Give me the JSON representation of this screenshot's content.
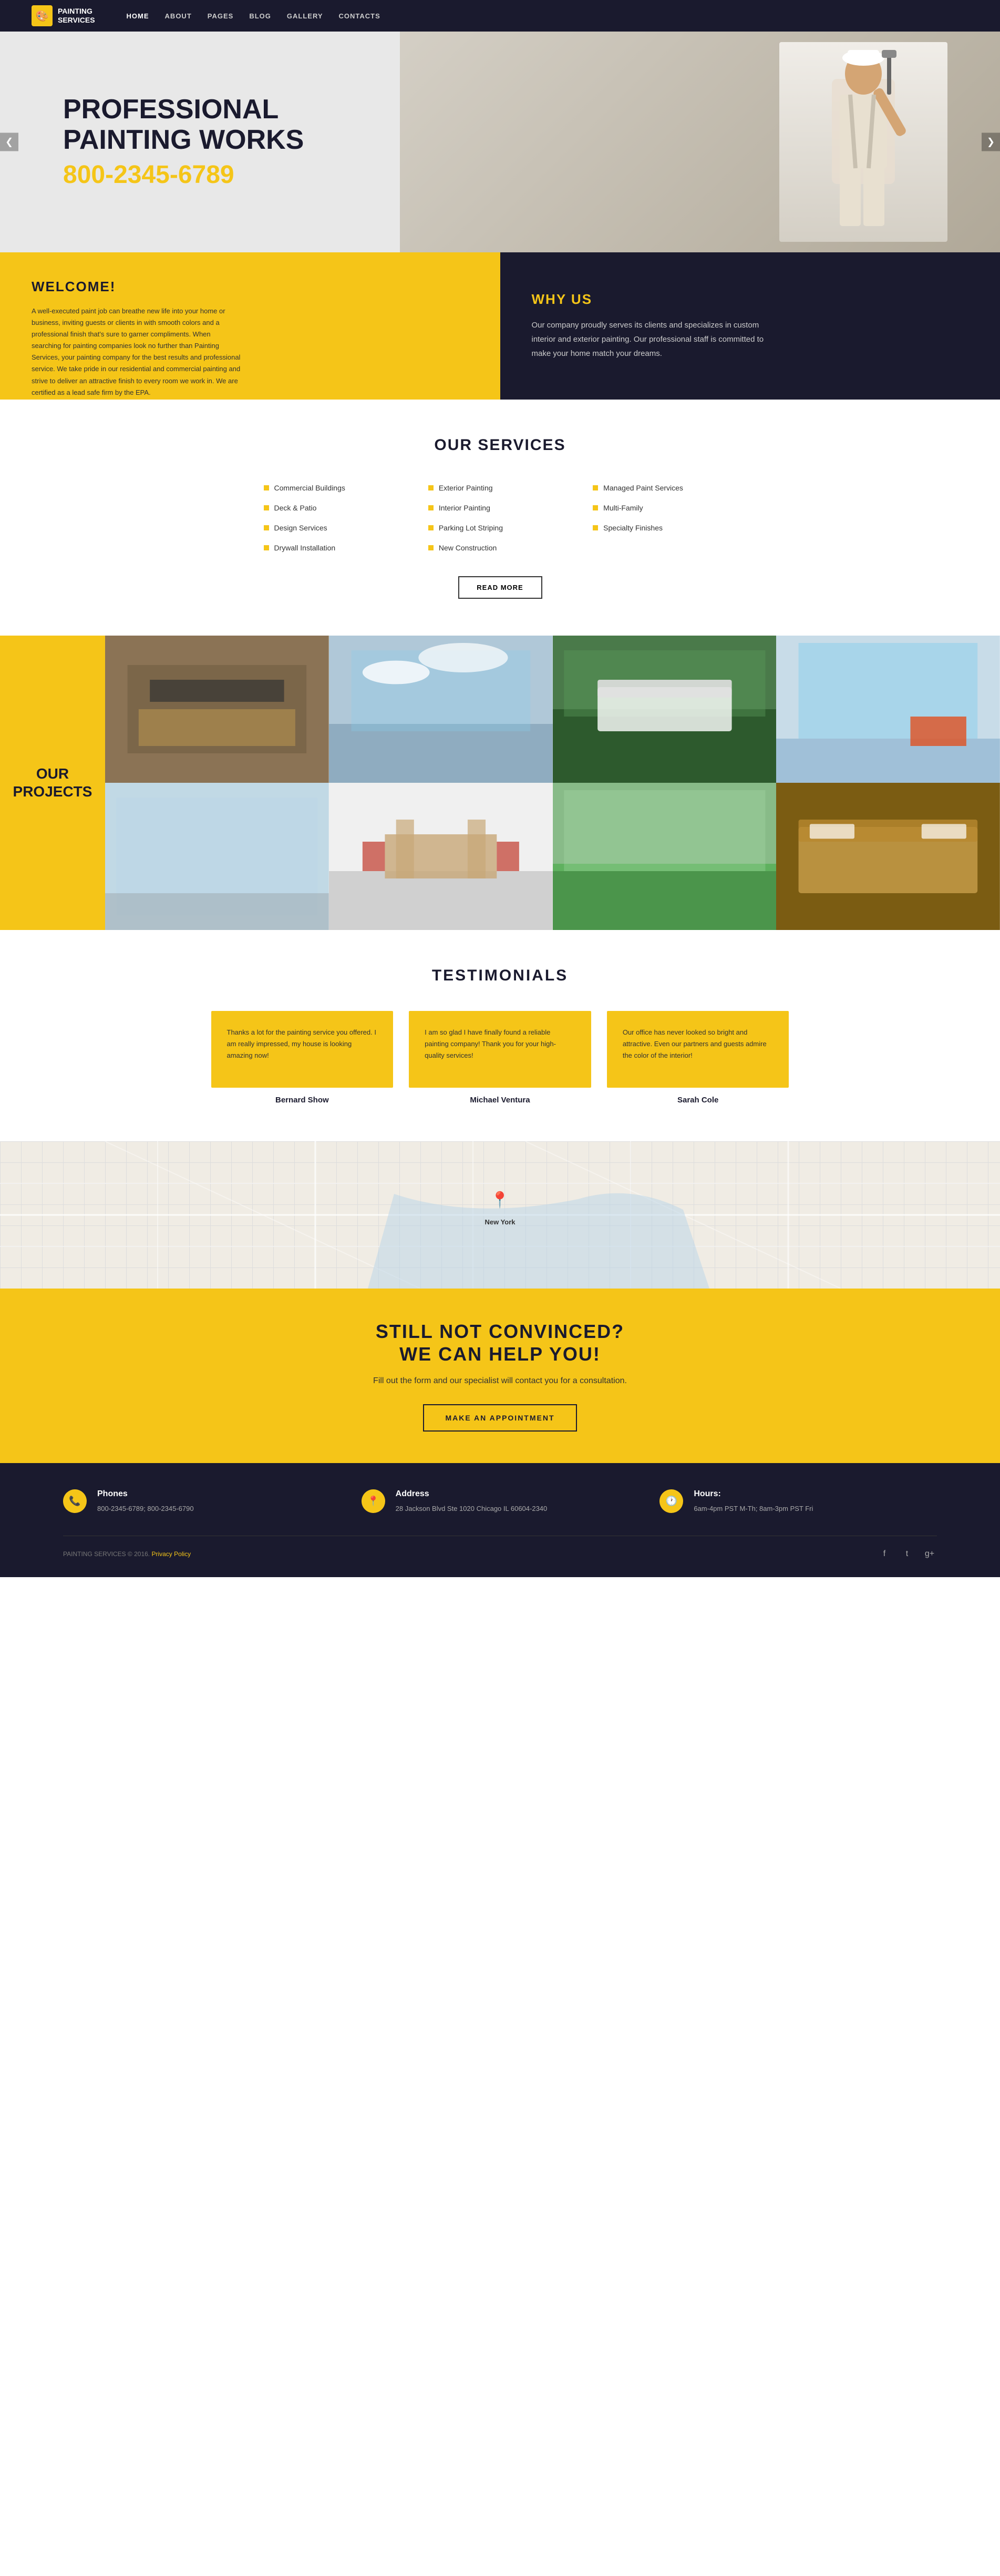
{
  "nav": {
    "logo_icon": "🎨",
    "logo_line1": "PAINTING",
    "logo_line2": "SERVICES",
    "links": [
      {
        "label": "HOME",
        "active": true
      },
      {
        "label": "ABOUT",
        "active": false
      },
      {
        "label": "PAGES",
        "active": false
      },
      {
        "label": "BLOG",
        "active": false
      },
      {
        "label": "GALLERY",
        "active": false
      },
      {
        "label": "CONTACTS",
        "active": false
      }
    ]
  },
  "hero": {
    "title_line1": "PROFESSIONAL",
    "title_line2": "PAINTING WORKS",
    "phone": "800-2345-6789",
    "arrow_left": "❮",
    "arrow_right": "❯"
  },
  "welcome": {
    "title": "WELCOME!",
    "body": "A well-executed paint job can breathe new life into your home or business, inviting guests or clients in with smooth colors and a professional finish that's sure to garner compliments. When searching for painting companies look no further than Painting Services, your painting company for the best results and professional service. We take pride in our residential and commercial painting and strive to deliver an attractive finish to every room we work in. We are certified as a lead safe firm by the EPA."
  },
  "whyus": {
    "title": "WHY US",
    "body": "Our company proudly serves its clients and specializes in custom interior and exterior painting. Our professional staff is committed to make your home match your dreams."
  },
  "services": {
    "title": "OUR SERVICES",
    "items": [
      "Commercial Buildings",
      "Deck & Patio",
      "Design Services",
      "Drywall Installation",
      "Exterior Painting",
      "Interior Painting",
      "Parking Lot Striping",
      "New Construction",
      "Managed Paint Services",
      "Multi-Family",
      "Specialty Finishes"
    ],
    "read_more": "READ MORE"
  },
  "projects": {
    "title_line1": "OUR",
    "title_line2": "PROJECTS",
    "thumbs": [
      {
        "id": 1,
        "class": "pt1"
      },
      {
        "id": 2,
        "class": "pt2"
      },
      {
        "id": 3,
        "class": "pt3"
      },
      {
        "id": 4,
        "class": "pt4"
      },
      {
        "id": 5,
        "class": "pt5"
      },
      {
        "id": 6,
        "class": "pt6"
      },
      {
        "id": 7,
        "class": "pt7"
      },
      {
        "id": 8,
        "class": "pt8"
      }
    ]
  },
  "testimonials": {
    "title": "TESTIMONIALS",
    "items": [
      {
        "text": "Thanks a lot for the painting service you offered. I am really impressed, my house is looking amazing now!",
        "name": "Bernard Show"
      },
      {
        "text": "I am so glad I have finally found a reliable painting company! Thank you for your high-quality services!",
        "name": "Michael Ventura"
      },
      {
        "text": "Our office has never looked so bright and attractive. Even our partners and guests admire the color of the interior!",
        "name": "Sarah Cole"
      }
    ]
  },
  "map": {
    "pin": "📍",
    "city_label": "New York"
  },
  "cta": {
    "title_line1": "STILL NOT CONVINCED?",
    "title_line2": "WE CAN HELP YOU!",
    "subtitle": "Fill out the form and our specialist will contact you for a consultation.",
    "button": "MAKE AN APPOINTMENT"
  },
  "footer": {
    "cols": [
      {
        "icon": "📞",
        "title": "Phones",
        "content": "800-2345-6789;\n800-2345-6790"
      },
      {
        "icon": "📍",
        "title": "Address",
        "content": "28 Jackson Blvd Ste 1020\nChicago IL 60604-2340"
      },
      {
        "icon": "🕐",
        "title": "Hours:",
        "content": "6am-4pm PST M-Th;\n8am-3pm PST Fri"
      }
    ],
    "copyright": "PAINTING SERVICES © 2016.",
    "privacy_link": "Privacy Policy",
    "social_icons": [
      "f",
      "t",
      "g+"
    ]
  }
}
